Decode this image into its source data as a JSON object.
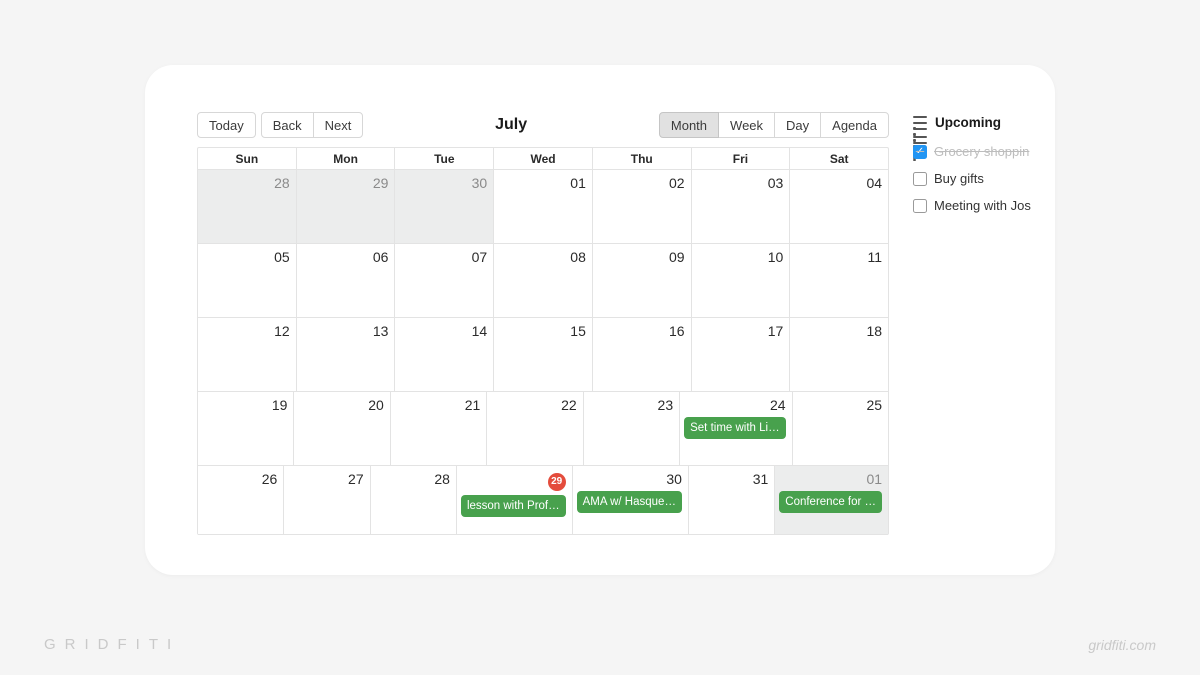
{
  "toolbar": {
    "today": "Today",
    "back": "Back",
    "next": "Next",
    "title": "July",
    "views": {
      "month": "Month",
      "week": "Week",
      "day": "Day",
      "agenda": "Agenda",
      "active": "month"
    }
  },
  "dayheads": [
    "Sun",
    "Mon",
    "Tue",
    "Wed",
    "Thu",
    "Fri",
    "Sat"
  ],
  "weeks": [
    [
      {
        "n": "28",
        "out": true
      },
      {
        "n": "29",
        "out": true
      },
      {
        "n": "30",
        "out": true
      },
      {
        "n": "01"
      },
      {
        "n": "02"
      },
      {
        "n": "03"
      },
      {
        "n": "04"
      }
    ],
    [
      {
        "n": "05"
      },
      {
        "n": "06"
      },
      {
        "n": "07"
      },
      {
        "n": "08"
      },
      {
        "n": "09"
      },
      {
        "n": "10"
      },
      {
        "n": "11"
      }
    ],
    [
      {
        "n": "12"
      },
      {
        "n": "13"
      },
      {
        "n": "14"
      },
      {
        "n": "15"
      },
      {
        "n": "16"
      },
      {
        "n": "17"
      },
      {
        "n": "18"
      }
    ],
    [
      {
        "n": "19"
      },
      {
        "n": "20"
      },
      {
        "n": "21"
      },
      {
        "n": "22"
      },
      {
        "n": "23"
      },
      {
        "n": "24",
        "events": [
          "Set time with Li…"
        ]
      },
      {
        "n": "25"
      }
    ],
    [
      {
        "n": "26"
      },
      {
        "n": "27"
      },
      {
        "n": "28"
      },
      {
        "n": "29",
        "today": true,
        "events": [
          "lesson with Prof…"
        ]
      },
      {
        "n": "30",
        "events": [
          "AMA w/ Hasque…"
        ]
      },
      {
        "n": "31"
      },
      {
        "n": "01",
        "out": true,
        "events": [
          "Conference for …"
        ]
      }
    ]
  ],
  "sidebar": {
    "title": "Upcoming",
    "items": [
      {
        "label": "Grocery shoppin",
        "done": true
      },
      {
        "label": "Buy gifts",
        "done": false
      },
      {
        "label": "Meeting with Jos",
        "done": false
      }
    ]
  },
  "watermark": {
    "left": "GRIDFITI",
    "right": "gridfiti.com"
  }
}
